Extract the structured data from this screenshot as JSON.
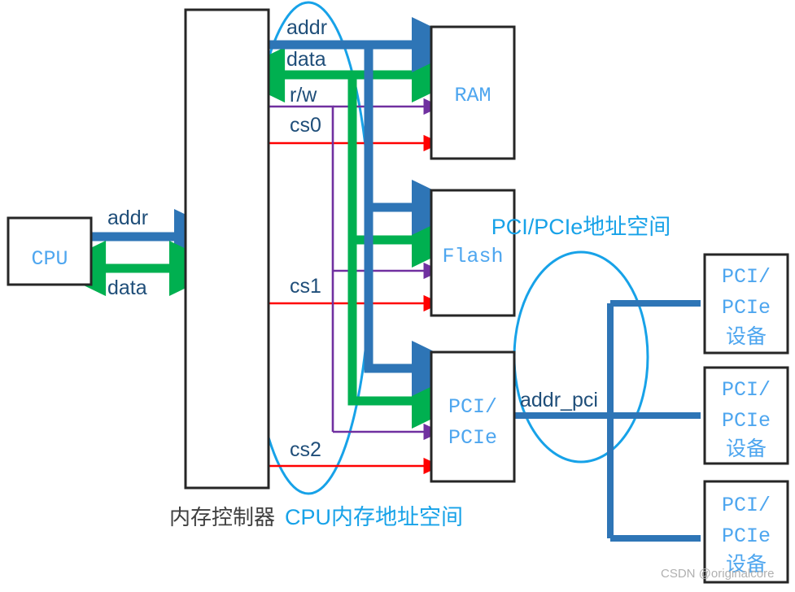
{
  "diagram": {
    "title_cpu_space": "CPU内存地址空间",
    "title_pci_space": "PCI/PCIe地址空间",
    "controller_caption": "内存控制器",
    "watermark": "CSDN @originalcore",
    "colors": {
      "addr_blue": "#2e75b6",
      "data_green": "#00b050",
      "rw_purple": "#7030a0",
      "cs_red": "#ff0000",
      "ellipse_cyan": "#17a2e8",
      "box_border": "#262626",
      "box_text": "#4ea6ef",
      "signal_text": "#1f4e79",
      "caption_gray": "#404040",
      "watermark_gray": "#b0b0b0"
    },
    "boxes": [
      {
        "id": "cpu",
        "label": "CPU",
        "lines": [
          "CPU"
        ]
      },
      {
        "id": "memory-controller",
        "label": "内存控制器",
        "lines": []
      },
      {
        "id": "ram",
        "label": "RAM",
        "lines": [
          "RAM"
        ]
      },
      {
        "id": "flash",
        "label": "Flash",
        "lines": [
          "Flash"
        ]
      },
      {
        "id": "pcie-controller",
        "label": "PCI/PCIe",
        "lines": [
          "PCI/",
          "PCIe"
        ]
      },
      {
        "id": "pcie-device-1",
        "label": "PCI/PCIe 设备",
        "lines": [
          "PCI/",
          "PCIe",
          "设备"
        ]
      },
      {
        "id": "pcie-device-2",
        "label": "PCI/PCIe 设备",
        "lines": [
          "PCI/",
          "PCIe",
          "设备"
        ]
      },
      {
        "id": "pcie-device-3",
        "label": "PCI/PCIe 设备",
        "lines": [
          "PCI/",
          "PCIe",
          "设备"
        ]
      }
    ],
    "signals": [
      {
        "id": "cpu-addr",
        "label": "addr",
        "color": "#2e75b6",
        "direction": "one-way"
      },
      {
        "id": "cpu-data",
        "label": "data",
        "color": "#00b050",
        "direction": "two-way"
      },
      {
        "id": "bus-addr",
        "label": "addr",
        "color": "#2e75b6",
        "direction": "one-way"
      },
      {
        "id": "bus-data",
        "label": "data",
        "color": "#00b050",
        "direction": "two-way"
      },
      {
        "id": "bus-rw",
        "label": "r/w",
        "color": "#7030a0",
        "direction": "one-way"
      },
      {
        "id": "cs0",
        "label": "cs0",
        "color": "#ff0000",
        "direction": "one-way"
      },
      {
        "id": "cs1",
        "label": "cs1",
        "color": "#ff0000",
        "direction": "one-way"
      },
      {
        "id": "cs2",
        "label": "cs2",
        "color": "#ff0000",
        "direction": "one-way"
      },
      {
        "id": "addr-pci",
        "label": "addr_pci",
        "color": "#2e75b6",
        "direction": "one-way"
      }
    ]
  }
}
